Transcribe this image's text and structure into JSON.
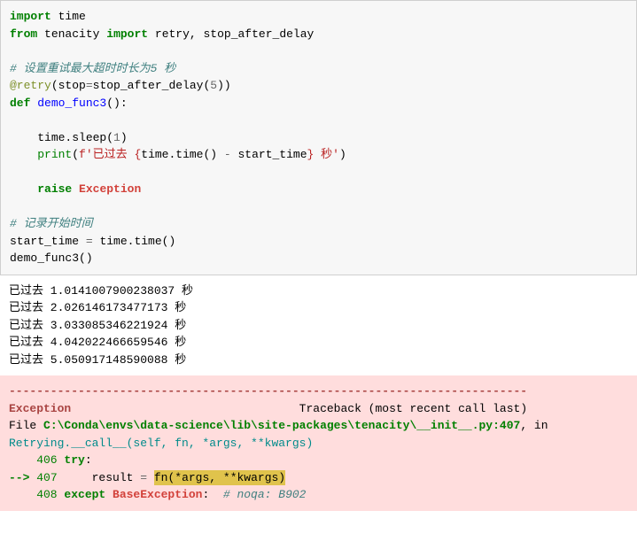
{
  "code": {
    "kw_import": "import",
    "mod_time": "time",
    "kw_from": "from",
    "mod_tenacity": "tenacity",
    "names_retry_stop": "retry, stop_after_delay",
    "comment1": "# 设置重试最大超时时长为5 秒",
    "decorator_at": "@retry",
    "decorator_call_open": "(stop",
    "decorator_eq": "=",
    "decorator_stop": "stop_after_delay(",
    "decorator_num": "5",
    "decorator_close": "))",
    "kw_def": "def",
    "func_name": "demo_func3",
    "func_parens": "():",
    "sleep_call": "time.sleep(",
    "sleep_num": "1",
    "sleep_close": ")",
    "print_name": "print",
    "print_open": "(",
    "fstr_prefix": "f'已过去 ",
    "fstr_expr_open": "{",
    "fstr_expr": "time.time() ",
    "fstr_minus": "-",
    "fstr_start": " start_time",
    "fstr_expr_close": "}",
    "fstr_suffix": " 秒'",
    "print_close": ")",
    "kw_raise": "raise",
    "exc_name": "Exception",
    "comment2": "# 记录开始时间",
    "assign_left": "start_time ",
    "assign_op": "=",
    "assign_right": " time.time()",
    "call_demo": "demo_func3()"
  },
  "output": {
    "line1": "已过去 1.0141007900238037 秒",
    "line2": "已过去 2.026146173477173 秒",
    "line3": "已过去 3.033085346221924 秒",
    "line4": "已过去 4.042022466659546 秒",
    "line5": "已过去 5.050917148590088 秒"
  },
  "traceback": {
    "dashes": "---------------------------------------------------------------------------",
    "exc_label": "Exception",
    "tb_header": "Traceback (most recent call last)",
    "file_prefix": "File ",
    "file_path": "C:\\Conda\\envs\\data-science\\lib\\site-packages\\tenacity\\__init__.py:407",
    "file_suffix": ", in ",
    "tb_sig": "Retrying.__call__(self, fn, *args, **kwargs)",
    "l406_num": "    406",
    "l406_try": " try",
    "l406_colon": ":",
    "arrow": "--> ",
    "l407_num": "407",
    "l407_indent": "     result ",
    "l407_eq": "=",
    "l407_space": " ",
    "l407_hl": "fn(*args, **kwargs)",
    "l408_num": "    408",
    "l408_except": " except",
    "l408_base": " BaseException",
    "l408_colon": ":",
    "l408_comment": "  # noqa: B902"
  }
}
